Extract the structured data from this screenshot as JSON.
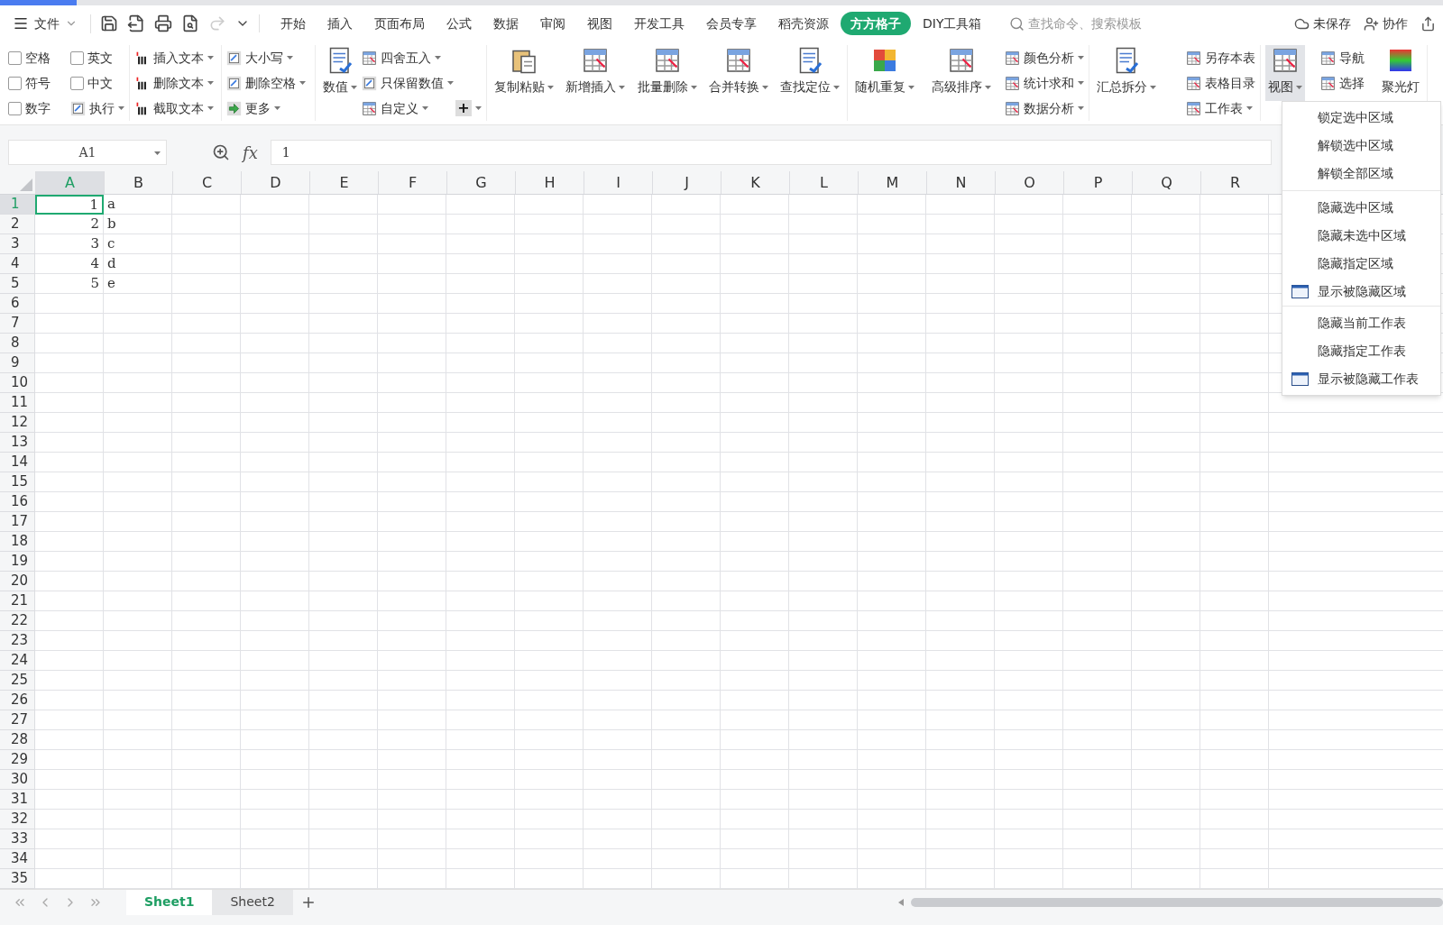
{
  "menu_bar": {
    "file_menu": "文件",
    "tabs": [
      {
        "label": "开始",
        "selected": false
      },
      {
        "label": "插入",
        "selected": false
      },
      {
        "label": "页面布局",
        "selected": false
      },
      {
        "label": "公式",
        "selected": false
      },
      {
        "label": "数据",
        "selected": false
      },
      {
        "label": "审阅",
        "selected": false
      },
      {
        "label": "视图",
        "selected": false
      },
      {
        "label": "开发工具",
        "selected": false
      },
      {
        "label": "会员专享",
        "selected": false
      },
      {
        "label": "稻壳资源",
        "selected": false
      },
      {
        "label": "方方格子",
        "selected": true
      },
      {
        "label": "DIY工具箱",
        "selected": false
      }
    ],
    "search": {
      "placeholder": "查找命令、搜索模板"
    },
    "actions": [
      {
        "label": "未保存",
        "kind": "cloud"
      },
      {
        "label": "协作",
        "kind": "user"
      }
    ]
  },
  "ribbon": [
    {
      "columns": [
        [
          {
            "kind": "checkbox",
            "label": "空格",
            "checked": false
          },
          {
            "kind": "checkbox",
            "label": "符号",
            "checked": false
          },
          {
            "kind": "checkbox",
            "label": "数字",
            "checked": false
          }
        ],
        [
          {
            "kind": "checkbox",
            "label": "英文",
            "checked": false
          },
          {
            "kind": "checkbox",
            "label": "中文",
            "checked": false
          },
          {
            "kind": "small",
            "label": "执行",
            "dropdown": true
          }
        ]
      ]
    },
    {
      "columns": [
        [
          {
            "kind": "small",
            "label": "插入文本",
            "dropdown": true
          },
          {
            "kind": "small",
            "label": "删除文本",
            "dropdown": true
          },
          {
            "kind": "small",
            "label": "截取文本",
            "dropdown": true
          }
        ]
      ]
    },
    {
      "columns": [
        [
          {
            "kind": "small",
            "label": "大小写",
            "dropdown": true
          },
          {
            "kind": "small",
            "label": "删除空格",
            "dropdown": true
          },
          {
            "kind": "small",
            "label": "更多",
            "dropdown": true
          }
        ]
      ]
    },
    {
      "columns": [
        [
          {
            "kind": "large",
            "label": "数值",
            "dropdown": true,
            "pressed": false
          }
        ],
        [
          {
            "kind": "small",
            "label": "四舍五入",
            "dropdown": true
          },
          {
            "kind": "small",
            "label": "只保留数值",
            "dropdown": true
          },
          {
            "kind": "small",
            "label": "自定义",
            "dropdown": true
          }
        ],
        [
          {
            "kind": "symbol",
            "label": "+",
            "dropdown": true
          }
        ]
      ]
    },
    {
      "columns": [
        [
          {
            "kind": "large",
            "label": "复制粘贴",
            "dropdown": true,
            "pressed": false
          }
        ],
        [
          {
            "kind": "large",
            "label": "新增插入",
            "dropdown": true,
            "pressed": false
          }
        ],
        [
          {
            "kind": "large",
            "label": "批量删除",
            "dropdown": true,
            "pressed": false
          }
        ],
        [
          {
            "kind": "large",
            "label": "合并转换",
            "dropdown": true,
            "pressed": false
          }
        ],
        [
          {
            "kind": "large",
            "label": "查找定位",
            "dropdown": true,
            "pressed": false
          }
        ]
      ]
    },
    {
      "columns": [
        [
          {
            "kind": "large",
            "label": "随机重复",
            "dropdown": true,
            "pressed": false
          }
        ],
        [
          {
            "kind": "large",
            "label": "高级排序",
            "dropdown": true,
            "pressed": false
          }
        ],
        [
          {
            "kind": "small",
            "label": "颜色分析",
            "dropdown": true
          },
          {
            "kind": "small",
            "label": "统计求和",
            "dropdown": true
          },
          {
            "kind": "small",
            "label": "数据分析",
            "dropdown": true
          }
        ]
      ]
    },
    {
      "columns": [
        [
          {
            "kind": "large",
            "label": "汇总拆分",
            "dropdown": true,
            "pressed": false
          }
        ],
        [
          {
            "kind": "small",
            "label": "另存本表",
            "dropdown": false
          },
          {
            "kind": "small",
            "label": "表格目录",
            "dropdown": false
          },
          {
            "kind": "small",
            "label": "工作表",
            "dropdown": true
          }
        ]
      ]
    },
    {
      "columns": [
        [
          {
            "kind": "large",
            "label": "视图",
            "dropdown": true,
            "pressed": true
          }
        ],
        [
          {
            "kind": "small",
            "label": "导航",
            "dropdown": false
          },
          {
            "kind": "small",
            "label": "选择",
            "dropdown": false
          }
        ],
        [
          {
            "kind": "large",
            "label": "聚光灯",
            "dropdown": false,
            "pressed": false
          }
        ]
      ]
    }
  ],
  "formula_bar": {
    "name_box": "A1",
    "function_label": "fx",
    "value": "1"
  },
  "sheet": {
    "columns": [
      {
        "label": "A",
        "selected": true
      },
      {
        "label": "B",
        "selected": false
      },
      {
        "label": "C",
        "selected": false
      },
      {
        "label": "D",
        "selected": false
      },
      {
        "label": "E",
        "selected": false
      },
      {
        "label": "F",
        "selected": false
      },
      {
        "label": "G",
        "selected": false
      },
      {
        "label": "H",
        "selected": false
      },
      {
        "label": "I",
        "selected": false
      },
      {
        "label": "J",
        "selected": false
      },
      {
        "label": "K",
        "selected": false
      },
      {
        "label": "L",
        "selected": false
      },
      {
        "label": "M",
        "selected": false
      },
      {
        "label": "N",
        "selected": false
      },
      {
        "label": "O",
        "selected": false
      },
      {
        "label": "P",
        "selected": false
      },
      {
        "label": "Q",
        "selected": false
      },
      {
        "label": "R",
        "selected": false
      }
    ],
    "rows": [
      {
        "header": "1",
        "selected": true,
        "cells": [
          {
            "text": "1",
            "selected": true
          },
          {
            "text": "a",
            "selected": false
          }
        ]
      },
      {
        "header": "2",
        "selected": false,
        "cells": [
          {
            "text": "2",
            "selected": false
          },
          {
            "text": "b",
            "selected": false
          }
        ]
      },
      {
        "header": "3",
        "selected": false,
        "cells": [
          {
            "text": "3",
            "selected": false
          },
          {
            "text": "c",
            "selected": false
          }
        ]
      },
      {
        "header": "4",
        "selected": false,
        "cells": [
          {
            "text": "4",
            "selected": false
          },
          {
            "text": "d",
            "selected": false
          }
        ]
      },
      {
        "header": "5",
        "selected": false,
        "cells": [
          {
            "text": "5",
            "selected": false
          },
          {
            "text": "e",
            "selected": false
          }
        ]
      },
      {
        "header": "6",
        "selected": false
      },
      {
        "header": "7",
        "selected": false
      },
      {
        "header": "8",
        "selected": false
      },
      {
        "header": "9",
        "selected": false
      },
      {
        "header": "10",
        "selected": false
      },
      {
        "header": "11",
        "selected": false
      },
      {
        "header": "12",
        "selected": false
      },
      {
        "header": "13",
        "selected": false
      },
      {
        "header": "14",
        "selected": false
      },
      {
        "header": "15",
        "selected": false
      },
      {
        "header": "16",
        "selected": false
      },
      {
        "header": "17",
        "selected": false
      },
      {
        "header": "18",
        "selected": false
      },
      {
        "header": "19",
        "selected": false
      },
      {
        "header": "20",
        "selected": false
      },
      {
        "header": "21",
        "selected": false
      },
      {
        "header": "22",
        "selected": false
      },
      {
        "header": "23",
        "selected": false
      },
      {
        "header": "24",
        "selected": false
      },
      {
        "header": "25",
        "selected": false
      },
      {
        "header": "26",
        "selected": false
      },
      {
        "header": "27",
        "selected": false
      },
      {
        "header": "28",
        "selected": false
      },
      {
        "header": "29",
        "selected": false
      },
      {
        "header": "30",
        "selected": false
      },
      {
        "header": "31",
        "selected": false
      },
      {
        "header": "32",
        "selected": false
      },
      {
        "header": "33",
        "selected": false
      },
      {
        "header": "34",
        "selected": false
      },
      {
        "header": "35",
        "selected": false
      }
    ]
  },
  "view_menu": {
    "groups": [
      [
        {
          "label": "锁定选中区域",
          "has_icon": false
        },
        {
          "label": "解锁选中区域",
          "has_icon": false
        },
        {
          "label": "解锁全部区域",
          "has_icon": false
        }
      ],
      [
        {
          "label": "隐藏选中区域",
          "has_icon": false
        },
        {
          "label": "隐藏未选中区域",
          "has_icon": false
        },
        {
          "label": "隐藏指定区域",
          "has_icon": false
        },
        {
          "label": "显示被隐藏区域",
          "has_icon": true
        }
      ],
      [
        {
          "label": "隐藏当前工作表",
          "has_icon": false
        },
        {
          "label": "隐藏指定工作表",
          "has_icon": false
        },
        {
          "label": "显示被隐藏工作表",
          "has_icon": true
        }
      ]
    ]
  },
  "sheet_tabs": [
    {
      "label": "Sheet1",
      "selected": true
    },
    {
      "label": "Sheet2",
      "selected": false
    }
  ]
}
